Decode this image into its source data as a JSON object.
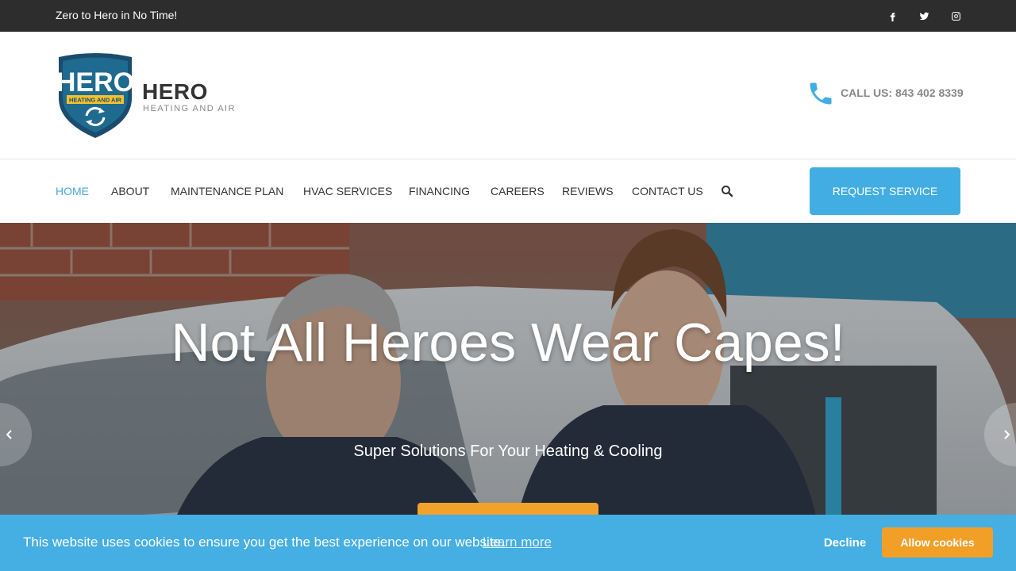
{
  "topbar": {
    "tagline": "Zero to Hero in No Time!",
    "social": [
      "facebook-icon",
      "twitter-icon",
      "instagram-icon"
    ]
  },
  "header": {
    "logo_text": "HERO",
    "logo_subtext": "HEATING AND AIR",
    "brand_name": "HERO",
    "brand_sub": "HEATING AND AIR",
    "call_text": "CALL US: 843 402 8339"
  },
  "nav": {
    "items": [
      {
        "label": "HOME"
      },
      {
        "label": "ABOUT"
      },
      {
        "label": "MAINTENANCE PLAN"
      },
      {
        "label": "HVAC SERVICES"
      },
      {
        "label": "FINANCING"
      },
      {
        "label": "CAREERS"
      },
      {
        "label": "REVIEWS"
      },
      {
        "label": "CONTACT US"
      }
    ],
    "cta": "REQUEST SERVICE"
  },
  "hero": {
    "title": "Not All Heroes Wear Capes!",
    "subtitle": "Super Solutions For Your Heating & Cooling"
  },
  "cookie": {
    "message": "This website uses cookies to ensure you get the best experience on our website.",
    "learn_more": "Learn more",
    "decline": "Decline",
    "allow": "Allow cookies"
  },
  "colors": {
    "accent": "#42ade2",
    "orange": "#f2a12a",
    "topbar": "#2d2d2d",
    "active_nav": "#4aa8dc"
  }
}
